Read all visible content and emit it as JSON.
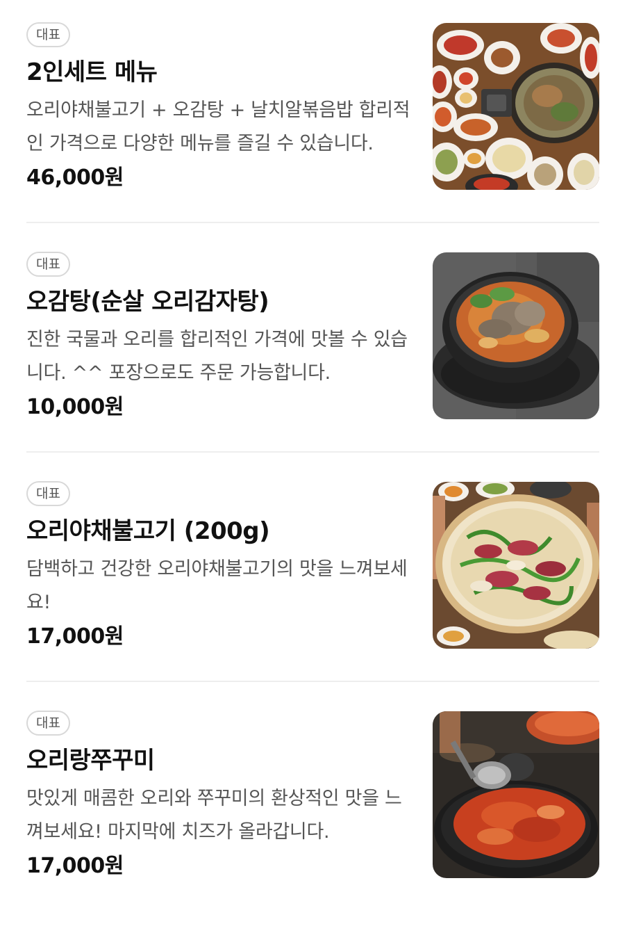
{
  "menu": {
    "items": [
      {
        "badge": "대표",
        "title": "2인세트 메뉴",
        "description": "오리야채불고기 + 오감탕 + 날치알볶음밥 합리적인 가격으로 다양한 메뉴를 즐길 수 있습니다.",
        "price": "46,000원"
      },
      {
        "badge": "대표",
        "title": "오감탕(순살 오리감자탕)",
        "description": "진한 국물과 오리를 합리적인 가격에 맛볼 수 있습니다. ^^ 포장으로도 주문 가능합니다.",
        "price": "10,000원"
      },
      {
        "badge": "대표",
        "title": "오리야채불고기 (200g)",
        "description": "담백하고 건강한 오리야채불고기의 맛을 느껴보세요!",
        "price": "17,000원"
      },
      {
        "badge": "대표",
        "title": "오리랑쭈꾸미",
        "description": "맛있게 매콤한 오리와 쭈꾸미의 환상적인 맛을 느껴보세요! 마지막에 치즈가 올라갑니다.",
        "price": "17,000원"
      }
    ]
  },
  "colors": {
    "text_primary": "#111111",
    "text_secondary": "#555555",
    "badge_border": "#d8d8d8",
    "divider": "#eeeeee"
  }
}
